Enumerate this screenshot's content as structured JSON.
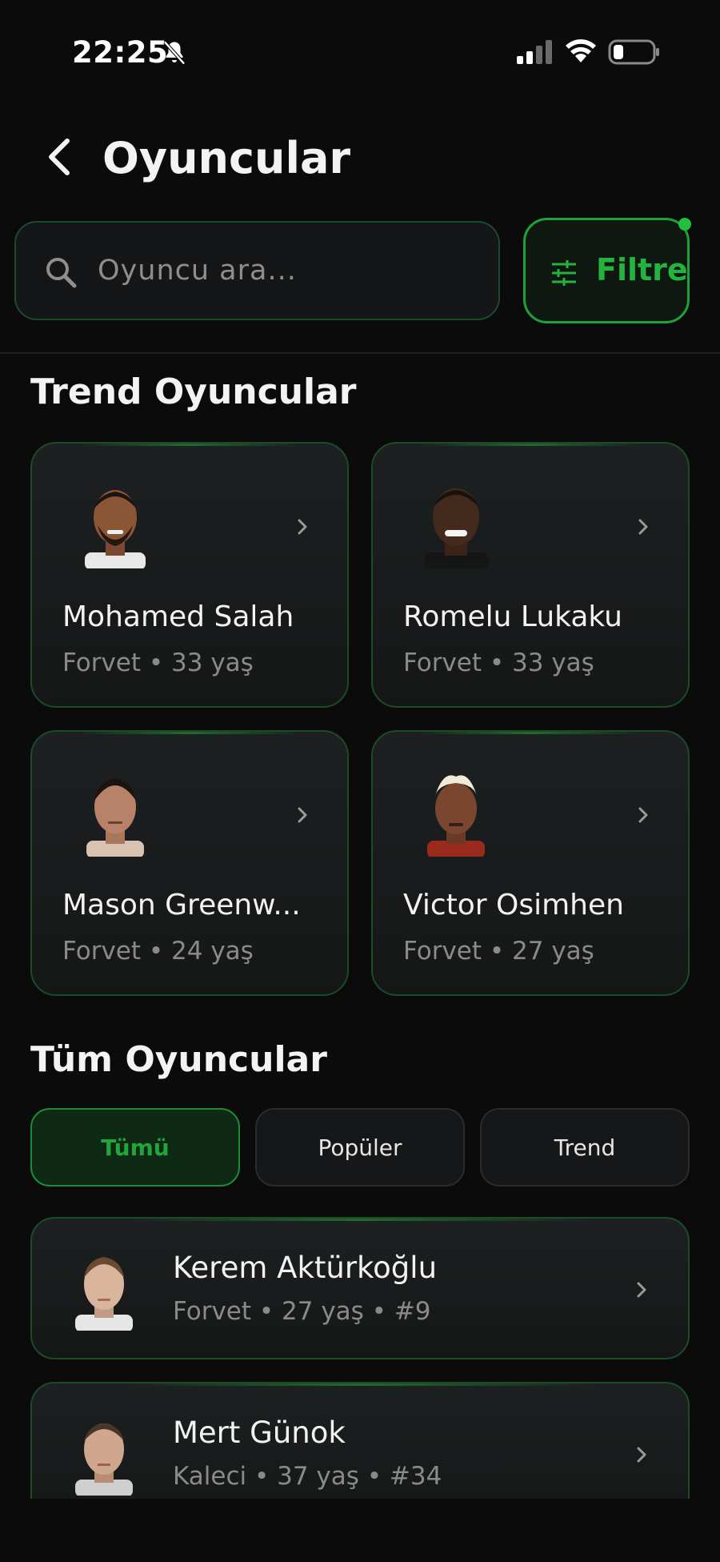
{
  "status_bar": {
    "time": "22:25"
  },
  "header": {
    "title": "Oyuncular",
    "back_icon": "chevron-left-icon"
  },
  "search": {
    "placeholder": "Oyuncu ara...",
    "icon": "search-icon"
  },
  "filter": {
    "label": "Filtre",
    "icon": "sliders-icon",
    "active_dot_color": "#22c040"
  },
  "trending": {
    "title": "Trend Oyuncular",
    "players": [
      {
        "name": "Mohamed Salah",
        "position": "Forvet",
        "age": "33 yaş"
      },
      {
        "name": "Romelu Lukaku",
        "position": "Forvet",
        "age": "33 yaş"
      },
      {
        "name": "Mason Greenw...",
        "position": "Forvet",
        "age": "24 yaş"
      },
      {
        "name": "Victor Osimhen",
        "position": "Forvet",
        "age": "27 yaş"
      }
    ]
  },
  "all_players": {
    "title": "Tüm Oyuncular",
    "tabs": [
      {
        "label": "Tümü",
        "active": true
      },
      {
        "label": "Popüler",
        "active": false
      },
      {
        "label": "Trend",
        "active": false
      }
    ],
    "rows": [
      {
        "name": "Kerem Aktürkoğlu",
        "position": "Forvet",
        "age": "27 yaş",
        "number": "#9"
      },
      {
        "name": "Mert Günok",
        "position": "Kaleci",
        "age": "37 yaş",
        "number": "#34"
      }
    ]
  },
  "colors": {
    "accent": "#24b33f",
    "background": "#0b0b0c",
    "card_border": "#1d4a27"
  }
}
